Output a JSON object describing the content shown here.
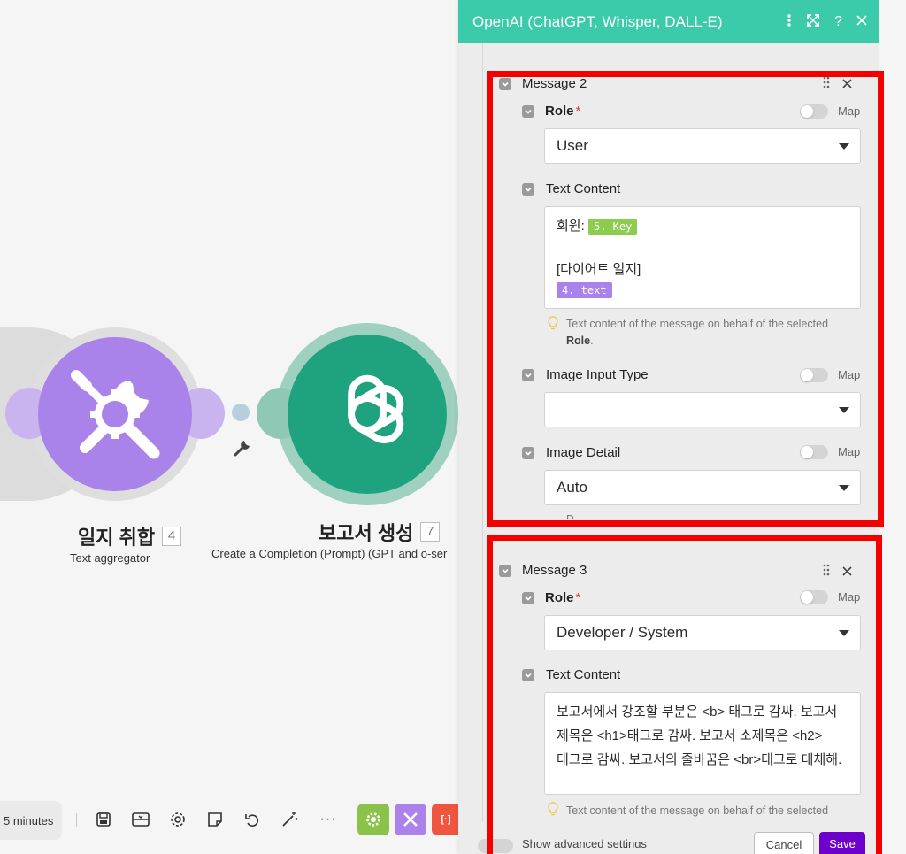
{
  "canvas": {
    "node_aggregator": {
      "title": "일지 취합",
      "badge": "4",
      "subtitle": "Text aggregator",
      "icon": "tools-icon",
      "color": "#a982ea"
    },
    "node_openai": {
      "title": "보고서 생성",
      "badge": "7",
      "subtitle": "Create a Completion (Prompt) (GPT and o-ser",
      "icon": "openai-logo-icon",
      "color": "#1ea37e"
    }
  },
  "toolbar": {
    "timer": "5 minutes",
    "icons": [
      "save-icon",
      "scenario-io-icon",
      "settings-icon",
      "notes-icon",
      "undo-icon",
      "magic-wand-icon",
      "more-icon"
    ],
    "color_buttons": [
      {
        "name": "tools-button",
        "color": "#8bc34a",
        "label": "⚙"
      },
      {
        "name": "flow-button",
        "color": "#a982ea",
        "label": "✖"
      },
      {
        "name": "json-button",
        "color": "#f0553f",
        "label": "[ ]"
      }
    ]
  },
  "panel": {
    "title": "OpenAI (ChatGPT, Whisper, DALL-E)",
    "header_icons": [
      "more-vertical-icon",
      "expand-icon",
      "help-icon",
      "close-icon"
    ],
    "message2": {
      "title": "Message 2",
      "role_label": "Role",
      "role_required": "*",
      "role_value": "User",
      "map_label": "Map",
      "text_content_label": "Text Content",
      "text_line1": "회원:",
      "text_pill1": "5. Key",
      "text_line2": "[다이어트 일지]",
      "text_pill2": "4. text",
      "hint_text": "Text content of the message on behalf of the selected",
      "hint_bold": "Role",
      "hint_end": ".",
      "image_input_label": "Image Input Type",
      "image_input_value": "",
      "image_detail_label": "Image Detail",
      "image_detail_value": "Auto",
      "cut_hint": "D"
    },
    "message3": {
      "title": "Message 3",
      "role_label": "Role",
      "role_required": "*",
      "role_value": "Developer / System",
      "map_label": "Map",
      "text_content_label": "Text Content",
      "text_value": "보고서에서 강조할 부분은 <b> 태그로 감싸. 보고서 제목은 <h1>태그로 감싸. 보고서 소제목은 <h2> 태그로 감싸. 보고서의 줄바꿈은 <br>태그로 대체해.",
      "hint_text": "Text content of the message on behalf of the selected"
    },
    "footer": {
      "advanced": "Show advanced settings",
      "cancel": "Cancel",
      "save": "Save"
    }
  },
  "colors": {
    "panel_header": "#3ccbaa",
    "highlight_box": "#f30000",
    "pill_green": "#8ccc4f",
    "pill_purple": "#a982ea",
    "save_button": "#6d00cc"
  }
}
